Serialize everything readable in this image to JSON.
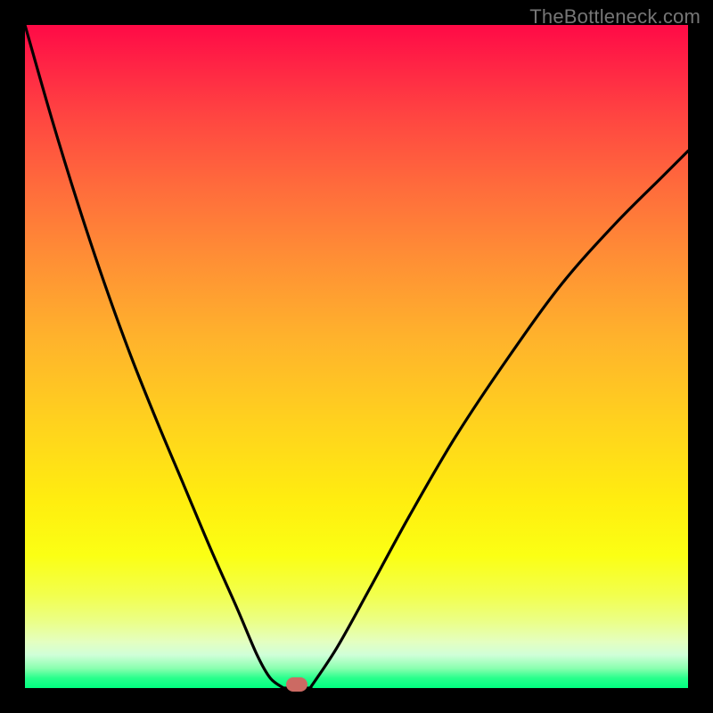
{
  "watermark": "TheBottleneck.com",
  "colors": {
    "frame": "#000000",
    "curve": "#000000",
    "marker": "#cc6a63"
  },
  "chart_data": {
    "type": "line",
    "title": "",
    "xlabel": "",
    "ylabel": "",
    "xlim": [
      0,
      1
    ],
    "ylim": [
      0,
      1
    ],
    "grid": false,
    "legend": false,
    "series": [
      {
        "name": "left-branch",
        "x": [
          0.0,
          0.04,
          0.08,
          0.12,
          0.16,
          0.2,
          0.24,
          0.28,
          0.32,
          0.35,
          0.37,
          0.39
        ],
        "y": [
          1.0,
          0.86,
          0.73,
          0.61,
          0.5,
          0.4,
          0.305,
          0.21,
          0.12,
          0.05,
          0.015,
          0.0
        ]
      },
      {
        "name": "floor",
        "x": [
          0.39,
          0.43
        ],
        "y": [
          0.0,
          0.0
        ]
      },
      {
        "name": "right-branch",
        "x": [
          0.43,
          0.47,
          0.52,
          0.58,
          0.65,
          0.73,
          0.81,
          0.89,
          0.96,
          1.0
        ],
        "y": [
          0.0,
          0.06,
          0.15,
          0.26,
          0.38,
          0.5,
          0.61,
          0.7,
          0.77,
          0.81
        ]
      }
    ],
    "marker": {
      "x": 0.41,
      "y": 0.005
    },
    "background_gradient": {
      "top": "#ff0a46",
      "mid": "#ffee0f",
      "bottom": "#00ff80"
    }
  }
}
